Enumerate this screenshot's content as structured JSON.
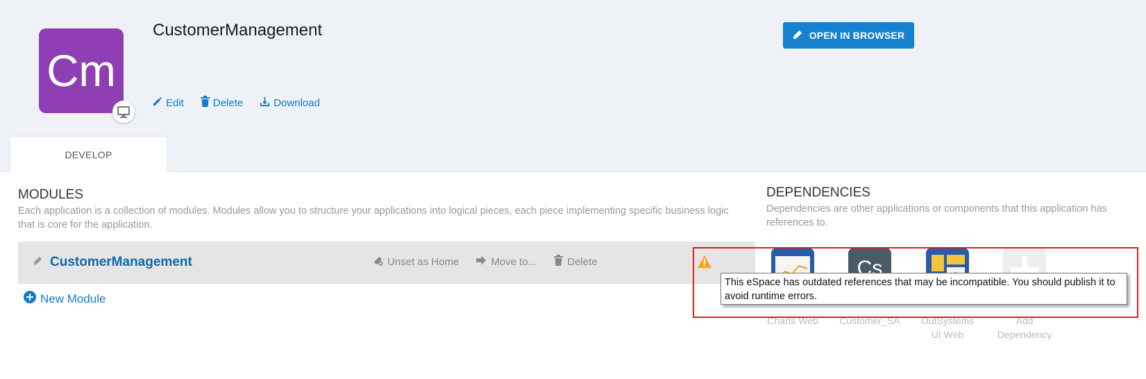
{
  "app": {
    "initials": "Cm",
    "title": "CustomerManagement",
    "icon_color": "#8f3fb3",
    "platform_icon": "monitor-icon"
  },
  "actions": {
    "edit": "Edit",
    "delete": "Delete",
    "download": "Download"
  },
  "open_in_browser": "OPEN IN BROWSER",
  "tabs": [
    {
      "label": "DEVELOP",
      "active": true
    }
  ],
  "modules_section": {
    "title": "MODULES",
    "description": "Each application is a collection of modules. Modules allow you to structure your applications into logical pieces, each piece implementing specific business logic that is core for the application.",
    "modules": [
      {
        "name": "CustomerManagement",
        "actions": {
          "unset_home": "Unset as Home",
          "move": "Move to...",
          "delete": "Delete"
        },
        "warning": true
      }
    ],
    "new_module": "New Module"
  },
  "dependencies_section": {
    "title": "DEPENDENCIES",
    "description": "Dependencies are other applications or components that this application has references to.",
    "items": [
      {
        "label": "Charts Web"
      },
      {
        "label": "Customer_SA",
        "initials": "Cs"
      },
      {
        "label": "OutSystems UI Web"
      },
      {
        "label": "Add Dependency"
      }
    ]
  },
  "tooltip": {
    "text": "This eSpace has outdated references that may be incompatible. You should publish it to avoid runtime errors."
  },
  "colors": {
    "accent": "#1581cf",
    "link": "#1479c9",
    "warning": "#f5a623",
    "highlight": "#e31b1b"
  }
}
